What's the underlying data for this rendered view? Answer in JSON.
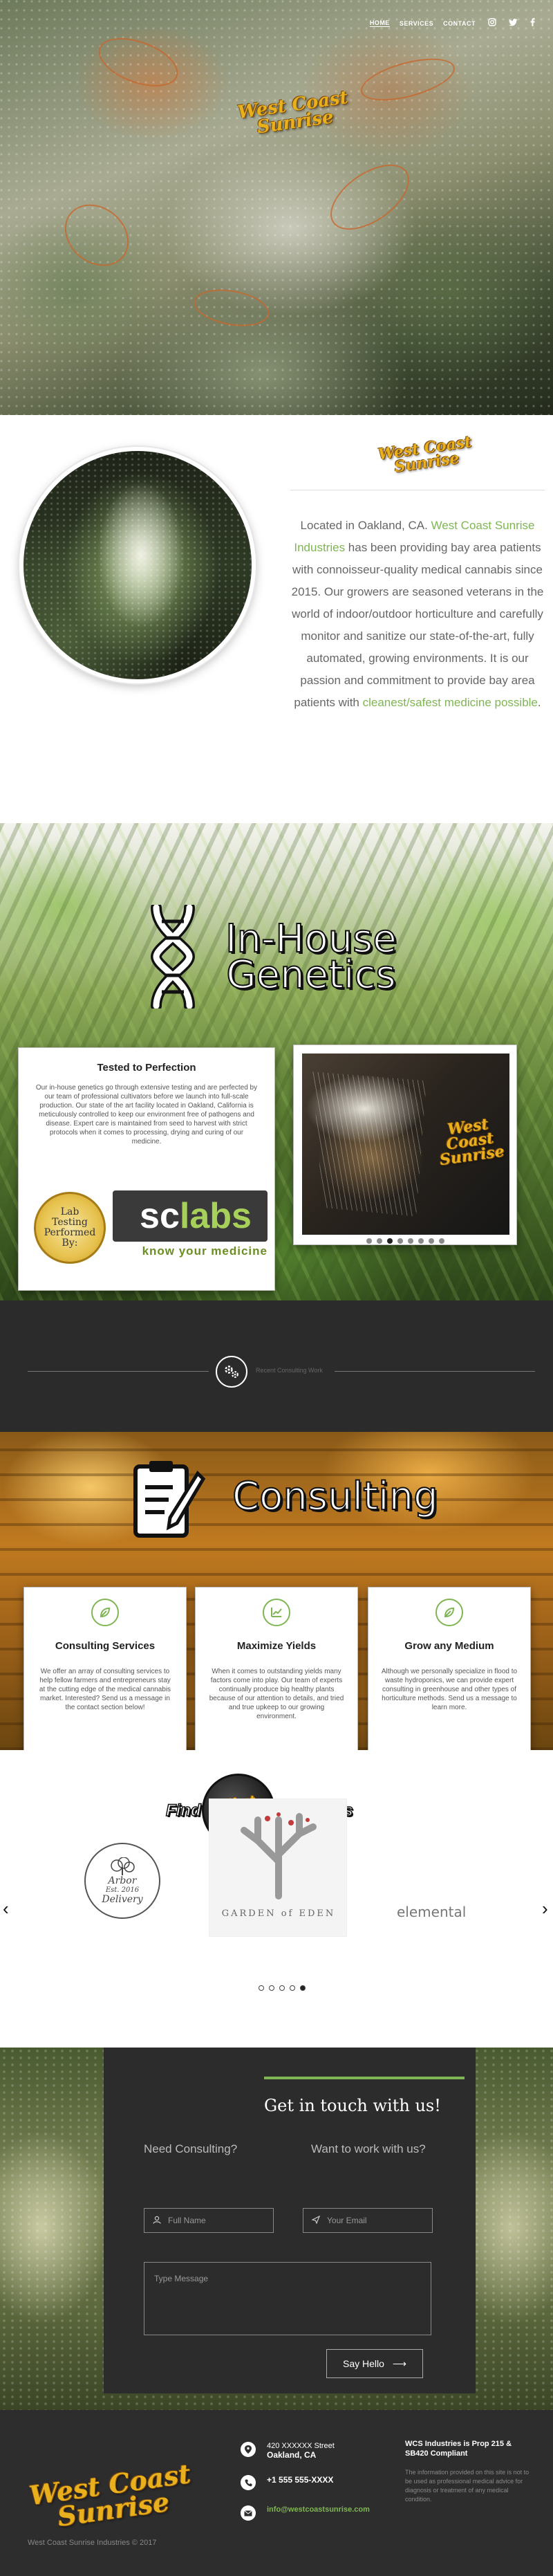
{
  "nav": {
    "items": [
      {
        "label": "HOME",
        "active": true
      },
      {
        "label": "SERVICES",
        "active": false
      },
      {
        "label": "CONTACT",
        "active": false
      }
    ],
    "social_icons": [
      "instagram-icon",
      "twitter-icon",
      "facebook-icon"
    ]
  },
  "brand": {
    "logo_line1": "West Coast",
    "logo_line2": "Sunrise",
    "colors": {
      "gold": "#e8b01c",
      "green": "#7fb653",
      "dark": "#2c2c2c"
    }
  },
  "about": {
    "text_a": "Located in Oakland, CA. ",
    "company": "West Coast Sunrise Industries",
    "text_b": " has been providing bay area patients with connoisseur-quality medical cannabis since 2015. Our growers are seasoned veterans in the world of indoor/outdoor horticulture and carefully monitor and sanitize our state-of-the-art, fully automated, growing environments. It is our passion and commitment to provide bay area patients with ",
    "highlight": "cleanest/safest medicine possible",
    "text_c": "."
  },
  "genetics": {
    "title_line1": "In-House",
    "title_line2": "Genetics",
    "card_title": "Tested to Perfection",
    "card_text": "Our in-house genetics go through extensive testing and are perfected by our team of professional cultivators before we launch into full-scale production. Our state of the art facility located in Oakland, California is meticulously controlled to keep our environment free of pathogens and disease. Expert care is maintained from seed to harvest with strict protocols when it comes to processing, drying and curing of our medicine.",
    "badge_lines": [
      "Lab",
      "Testing",
      "Performed",
      "By:"
    ],
    "sclabs_sc": "sc",
    "sclabs_labs": "labs",
    "sclabs_tag": "know your medicine",
    "slider_dots": 8,
    "slider_active": 2
  },
  "band": {
    "label": "Recent Consulting Work"
  },
  "consulting": {
    "title": "Consulting",
    "services": [
      {
        "icon": "leaf-icon",
        "title": "Consulting Services",
        "text": "We offer an array of consulting services to help fellow farmers and entrepreneurs stay at the cutting edge of the medical cannabis market. Interested? Send us a message in the contact section below!"
      },
      {
        "icon": "chart-icon",
        "title": "Maximize Yields",
        "text": "When it comes to outstanding yields many factors come into play. Our team of experts continually produce big healthy plants because of our attention to details, and tried and true upkeep to our growing environment."
      },
      {
        "icon": "leaf-icon",
        "title": "Grow any Medium",
        "text": "Although we personally specialize in flood to waste hydroponics, we can provide expert consulting in greenhouse and other types of horticulture methods. Send us a message to learn more."
      }
    ]
  },
  "partners": {
    "find_left": "Find",
    "find_right": "products here!",
    "arbor": [
      "Arbor",
      "Est. 2016",
      "Delivery"
    ],
    "eden": "GARDEN of EDEN",
    "elemental": "elemental",
    "dots": 5,
    "active": 4
  },
  "contact": {
    "heading": "Get in touch with us!",
    "q1": "Need Consulting?",
    "q2": "Want to work with us?",
    "name_placeholder": "Full Name",
    "email_placeholder": "Your Email",
    "message_placeholder": "Type Message",
    "submit": "Say Hello"
  },
  "footer": {
    "address_line1": "420 XXXXXX Street",
    "address_line2": "Oakland, CA",
    "phone": "+1 555 555-XXXX",
    "email": "info@westcoastsunrise.com",
    "copyright": "West Coast Sunrise Industries © 2017",
    "legal_title": "WCS Industries is Prop 215 & SB420 Compliant",
    "legal_text": "The information provided on this site is not to be used as professional medical advice for diagnosis or treatment of any medical condition."
  }
}
